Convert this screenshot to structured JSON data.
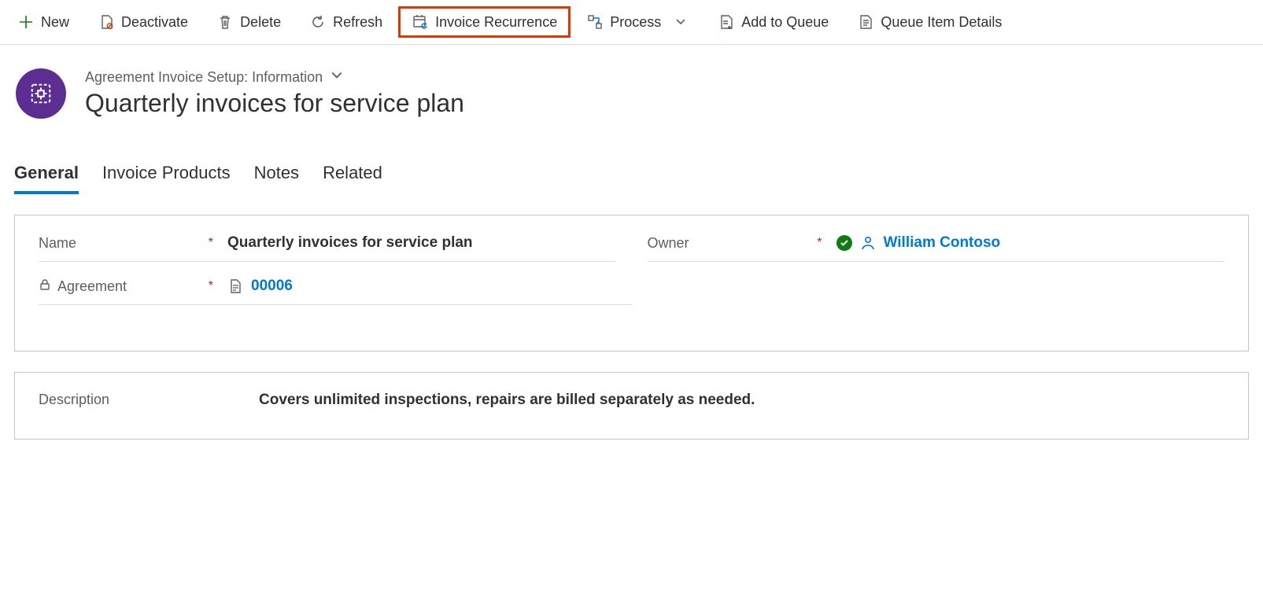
{
  "toolbar": {
    "new": "New",
    "deactivate": "Deactivate",
    "delete": "Delete",
    "refresh": "Refresh",
    "invoice_recurrence": "Invoice Recurrence",
    "process": "Process",
    "add_to_queue": "Add to Queue",
    "queue_item_details": "Queue Item Details"
  },
  "header": {
    "form_selector": "Agreement Invoice Setup: Information",
    "title": "Quarterly invoices for service plan"
  },
  "tabs": {
    "general": "General",
    "invoice_products": "Invoice Products",
    "notes": "Notes",
    "related": "Related"
  },
  "fields": {
    "name_label": "Name",
    "name_value": "Quarterly invoices for service plan",
    "owner_label": "Owner",
    "owner_value": "William Contoso",
    "agreement_label": "Agreement",
    "agreement_value": "00006",
    "description_label": "Description",
    "description_value": "Covers unlimited inspections, repairs are billed separately as needed."
  }
}
